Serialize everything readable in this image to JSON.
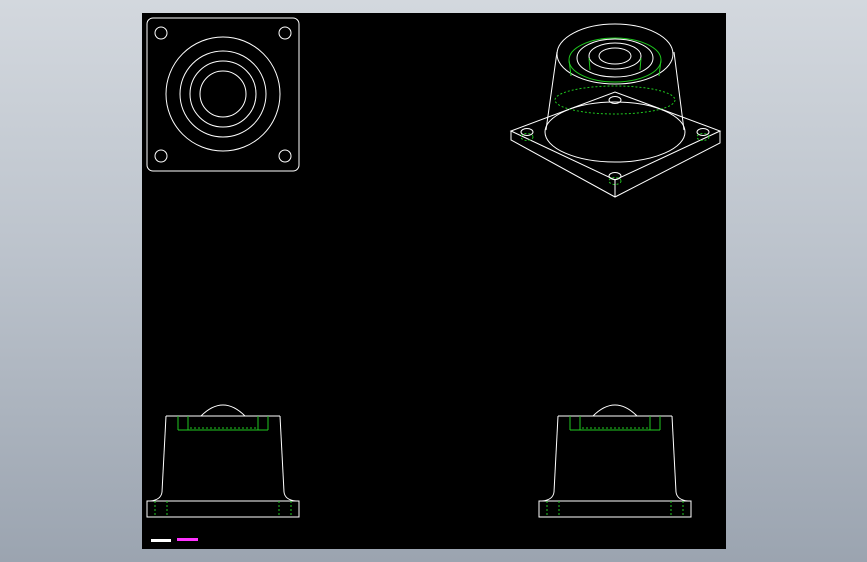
{
  "sheet": {
    "background": "#000000",
    "surround": "#b9c0c9"
  },
  "colors": {
    "visible_edge": "#ffffff",
    "hidden_edge": "#1fc81f",
    "title_text_a": "#ffffff",
    "title_text_b": "#ff33ff"
  },
  "views": [
    {
      "name": "top-view"
    },
    {
      "name": "isometric-view"
    },
    {
      "name": "front-view"
    },
    {
      "name": "side-view"
    }
  ],
  "title_block": {
    "text_a": "",
    "text_b": ""
  }
}
